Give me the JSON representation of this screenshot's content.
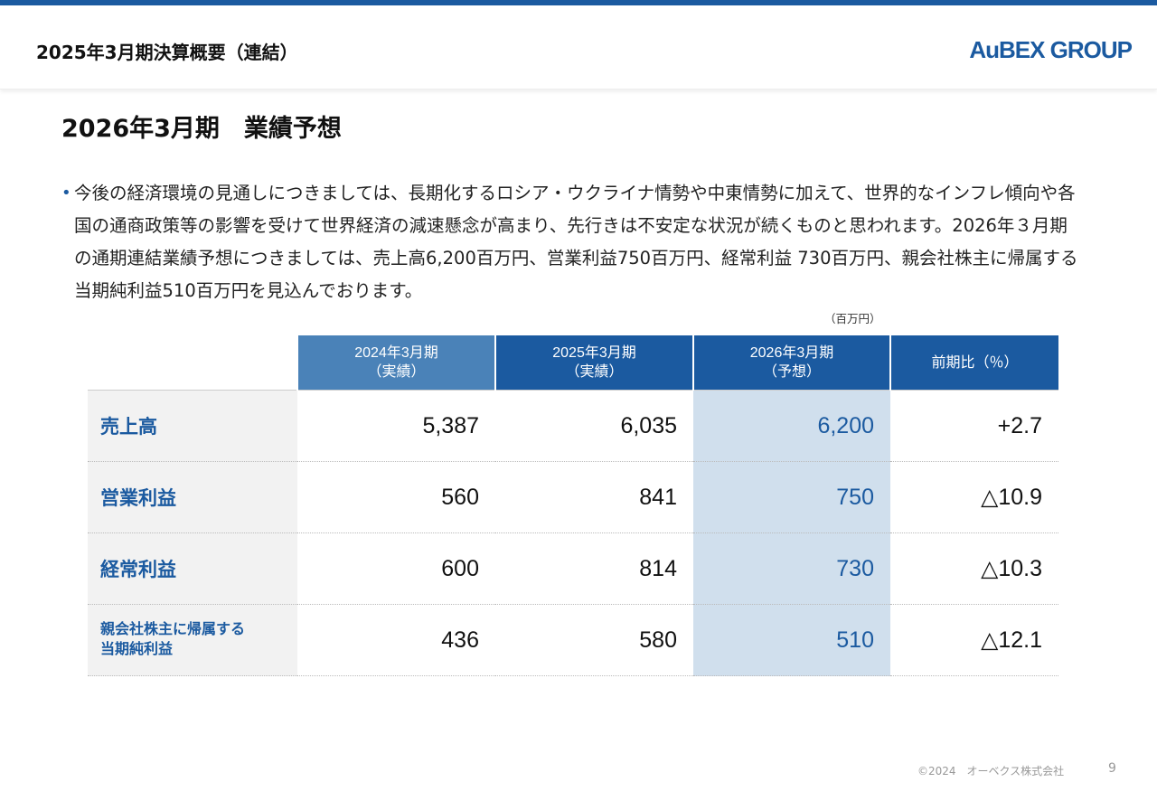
{
  "header": {
    "title": "2025年3月期決算概要（連結）",
    "logo_text": "AuBEX GROUP"
  },
  "page_title": "2026年3月期　業績予想",
  "bullet_text": "今後の経済環境の見通しにつきましては、長期化するロシア・ウクライナ情勢や中東情勢に加えて、世界的なインフレ傾向や各国の通商政策等の影響を受けて世界経済の減速懸念が高まり、先行きは不安定な状況が続くものと思われます。2026年３月期の通期連結業績予想につきましては、売上高6,200百万円、営業利益750百万円、経常利益 730百万円、親会社株主に帰属する当期純利益510百万円を見込んでおります。",
  "unit_label": "（百万円）",
  "table": {
    "columns": [
      {
        "line1": "2024年3月期",
        "line2": "（実績）"
      },
      {
        "line1": "2025年3月期",
        "line2": "（実績）"
      },
      {
        "line1": "2026年3月期",
        "line2": "（予想）"
      },
      {
        "line1": "前期比（％）",
        "line2": ""
      }
    ],
    "rows": [
      {
        "label": "売上高",
        "label2": "",
        "v2024": "5,387",
        "v2025": "6,035",
        "v2026": "6,200",
        "change": "+2.7"
      },
      {
        "label": "営業利益",
        "label2": "",
        "v2024": "560",
        "v2025": "841",
        "v2026": "750",
        "change": "△10.9"
      },
      {
        "label": "経常利益",
        "label2": "",
        "v2024": "600",
        "v2025": "814",
        "v2026": "730",
        "change": "△10.3"
      },
      {
        "label": "親会社株主に帰属する",
        "label2": "当期純利益",
        "v2024": "436",
        "v2025": "580",
        "v2026": "510",
        "change": "△12.1"
      }
    ]
  },
  "footer": {
    "copyright": "©2024　オーベクス株式会社",
    "page_number": "9"
  },
  "colors": {
    "brand_blue": "#1b5aa0",
    "header_light_blue": "#4a82b8",
    "forecast_highlight": "#d0dfed",
    "label_background": "#f2f2f2"
  }
}
